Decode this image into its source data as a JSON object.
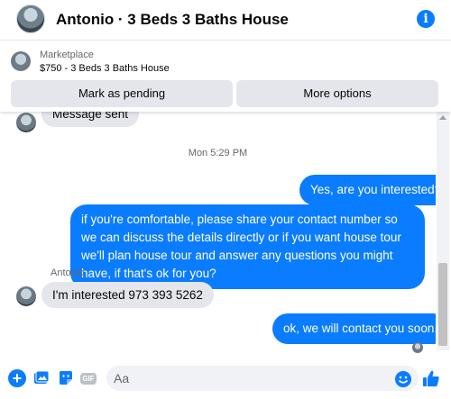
{
  "header": {
    "title": "Antonio · 3 Beds 3 Baths House",
    "info_glyph": "i"
  },
  "marketplace": {
    "label": "Marketplace",
    "listing": "$750 - 3 Beds 3 Baths House",
    "mark_pending_label": "Mark as pending",
    "more_options_label": "More options"
  },
  "thread": {
    "partial_message": "Message sent",
    "timestamp": "Mon 5:29 PM",
    "messages_out": [
      "Yes, are you interested?",
      "if you're comfortable, please share your contact number so we can discuss the details directly or if you want house tour we'll plan house tour and answer any questions you might have, if that's ok for you?"
    ],
    "sender_name": "Antonio",
    "message_in": "I'm interested 973 393 5262",
    "reply": "ok, we will contact you soon."
  },
  "composer": {
    "placeholder": "Aa",
    "value": "",
    "plus_glyph": "+",
    "gif_label": "GIF"
  },
  "colors": {
    "accent": "#0a7cff",
    "incoming_bubble": "#e4e6eb",
    "muted_text": "#65676b"
  },
  "icons": [
    "plus-icon",
    "photo-icon",
    "sticker-icon",
    "gif-icon",
    "emoji-icon",
    "like-icon",
    "info-icon"
  ]
}
